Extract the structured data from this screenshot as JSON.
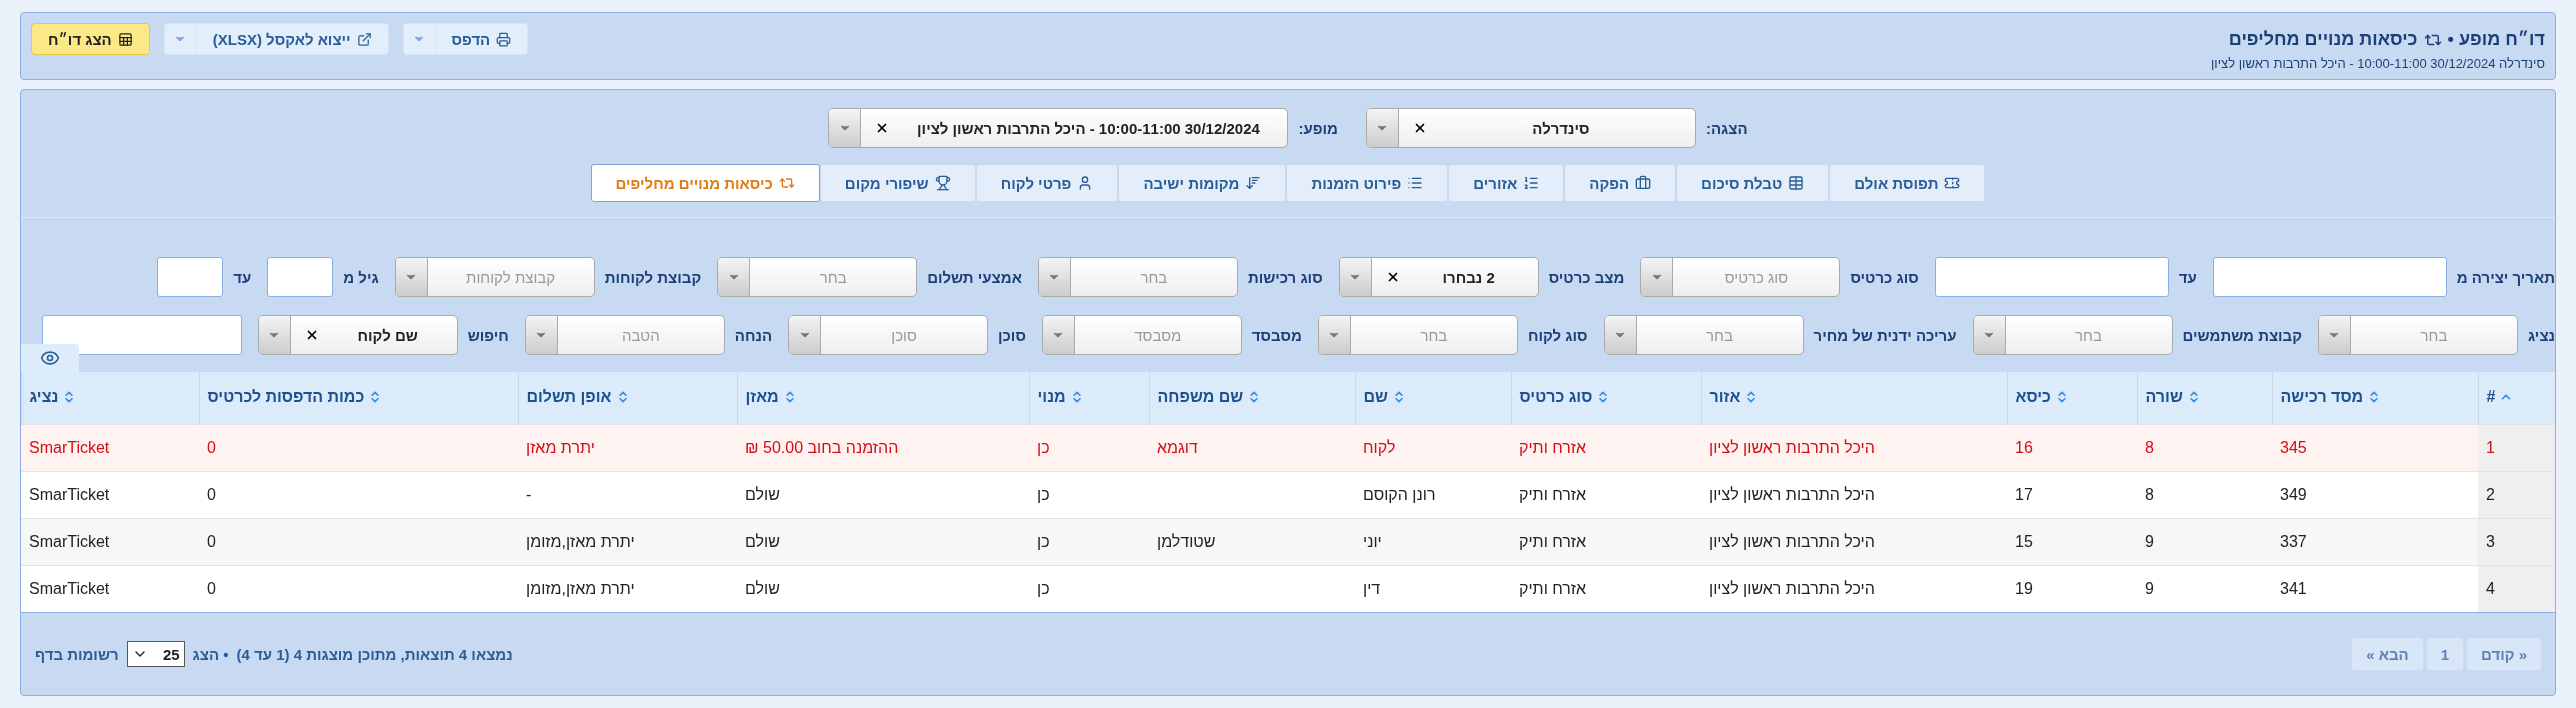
{
  "header": {
    "title_prefix": "דו״ח מופע •",
    "title": "כיסאות מנויים מחליפים",
    "subtitle": "סינדרלה 30/12/2024 10:00-11:00 - היכל התרבות ראשון לציון",
    "buttons": [
      {
        "kind": "split",
        "label": "הדפס"
      },
      {
        "kind": "split",
        "label": "ייצוא לאקסל (XLSX)"
      },
      {
        "kind": "primary",
        "label": "הצג דו״ח"
      }
    ]
  },
  "selectors": [
    {
      "label": "הצגה:",
      "value": "סינדרלה",
      "clearable": true
    },
    {
      "label": "מופע:",
      "value": "30/12/2024 10:00-11:00 - היכל התרבות ראשון לציון",
      "clearable": true
    }
  ],
  "tabs": [
    {
      "label": "תפוסת אולם",
      "selected": false
    },
    {
      "label": "טבלת סיכום",
      "selected": false
    },
    {
      "label": "הפקה",
      "selected": false
    },
    {
      "label": "אזורים",
      "selected": false
    },
    {
      "label": "פירוט הזמנות",
      "selected": false
    },
    {
      "label": "מקומות ישיבה",
      "selected": false
    },
    {
      "label": "פרטי לקוח",
      "selected": false
    },
    {
      "label": "שיפורי מקום",
      "selected": false
    },
    {
      "label": "כיסאות מנויים מחליפים",
      "selected": true
    }
  ],
  "filters": [
    [
      {
        "label": "תאריך יצירה מ",
        "kind": "input"
      },
      {
        "label": "עד",
        "kind": "input"
      },
      {
        "label": "סוג כרטיס",
        "kind": "select",
        "placeholder": "סוג כרטיס"
      },
      {
        "label": "מצב כרטיס",
        "kind": "select",
        "value": "2 נבחרו",
        "clearable": true
      },
      {
        "label": "סוג רכישות",
        "kind": "select",
        "placeholder": "בחר"
      },
      {
        "label": "אמצעי תשלום",
        "kind": "select",
        "placeholder": "בחר"
      },
      {
        "label": "קבוצת לקוחות",
        "kind": "select",
        "placeholder": "קבוצת לקוחות"
      },
      {
        "label": "גיל מ",
        "kind": "short"
      },
      {
        "label": "עד",
        "kind": "short"
      }
    ],
    [
      {
        "label": "נציג",
        "kind": "select",
        "placeholder": "בחר"
      },
      {
        "label": "קבוצת משתמשים",
        "kind": "select",
        "placeholder": "בחר"
      },
      {
        "label": "עריכה ידנית של מחיר",
        "kind": "select",
        "placeholder": "בחר"
      },
      {
        "label": "סוג לקוח",
        "kind": "select",
        "placeholder": "בחר"
      },
      {
        "label": "מסבסד",
        "kind": "select",
        "placeholder": "מסבסד"
      },
      {
        "label": "סוכן",
        "kind": "select",
        "placeholder": "סוכן"
      },
      {
        "label": "הנחה",
        "kind": "select",
        "placeholder": "הטבה"
      },
      {
        "label": "חיפוש",
        "kind": "select",
        "value": "שם לקוח",
        "clearable": true
      },
      {
        "kind": "input"
      }
    ]
  ],
  "table": {
    "columns": [
      {
        "label": "#",
        "sorted": true
      },
      {
        "label": "מסד רכישה",
        "sorted": false
      },
      {
        "label": "שורה",
        "sorted": false
      },
      {
        "label": "כיסא",
        "sorted": false
      },
      {
        "label": "אזור",
        "sorted": false
      },
      {
        "label": "סוג כרטיס",
        "sorted": false
      },
      {
        "label": "שם",
        "sorted": false
      },
      {
        "label": "שם משפחה",
        "sorted": false
      },
      {
        "label": "מנוי",
        "sorted": false
      },
      {
        "label": "מאזן",
        "sorted": false
      },
      {
        "label": "אופן תשלום",
        "sorted": false
      },
      {
        "label": "כמות הדפסות לכרטיס",
        "sorted": false
      },
      {
        "label": "נציג",
        "sorted": false
      }
    ],
    "rows": [
      {
        "alert": true,
        "cells": [
          "1",
          "345",
          "8",
          "16",
          "היכל התרבות ראשון לציון",
          "אזרח ותיק",
          "לקוח",
          "דוגמא",
          "כן",
          "ההזמנה בחוב 50.00 ₪",
          "יתרת מאזן",
          "0",
          "SmarTicket"
        ]
      },
      {
        "alert": false,
        "cells": [
          "2",
          "349",
          "8",
          "17",
          "היכל התרבות ראשון לציון",
          "אזרח ותיק",
          "רונן הקוסם",
          "",
          "כן",
          "שולם",
          "-",
          "0",
          "SmarTicket"
        ]
      },
      {
        "alert": false,
        "cells": [
          "3",
          "337",
          "9",
          "15",
          "היכל התרבות ראשון לציון",
          "אזרח ותיק",
          "יוני",
          "שטודלמן",
          "כן",
          "שולם",
          "יתרת מאזן,מזומן",
          "0",
          "SmarTicket"
        ]
      },
      {
        "alert": false,
        "cells": [
          "4",
          "341",
          "9",
          "19",
          "היכל התרבות ראשון לציון",
          "אזרח ותיק",
          "דין",
          "",
          "כן",
          "שולם",
          "יתרת מאזן,מזומן",
          "0",
          "SmarTicket"
        ]
      }
    ]
  },
  "footer": {
    "summary": "נמצאו 4 תוצאות, מתוכן מוצגות 4 (1 עד 4)",
    "show_label": "• הצג",
    "page_size": "25",
    "per_page_label": "רשומות בדף",
    "pager": [
      {
        "label": "« קודם",
        "disabled": true
      },
      {
        "label": "1",
        "disabled": true
      },
      {
        "label": "הבא »",
        "disabled": true
      }
    ]
  }
}
